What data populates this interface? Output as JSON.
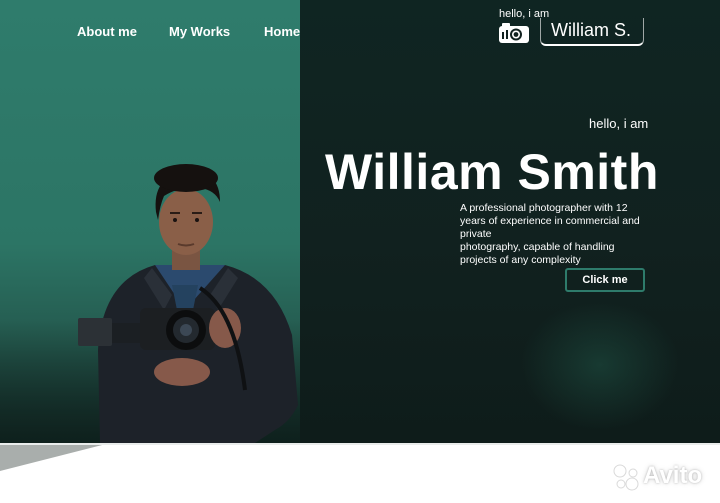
{
  "nav": {
    "items": [
      {
        "label": "About me"
      },
      {
        "label": "My Works"
      },
      {
        "label": "Home"
      }
    ]
  },
  "brand": {
    "greeting": "hello, i am",
    "name": "William S.",
    "icon": "camera-icon"
  },
  "hero": {
    "greeting": "hello, i am",
    "title": "William Smith",
    "description_lines": [
      "A professional photographer with 12",
      "years of experience in commercial and",
      "private",
      "photography, capable of handling",
      "projects of any complexity"
    ],
    "cta_label": "Click me"
  },
  "watermark": {
    "text": "Avito",
    "icon": "avito-logo-icon"
  },
  "colors": {
    "accent_green": "#2f7c6c",
    "dark_background": "#11211f",
    "text": "#ffffff"
  }
}
